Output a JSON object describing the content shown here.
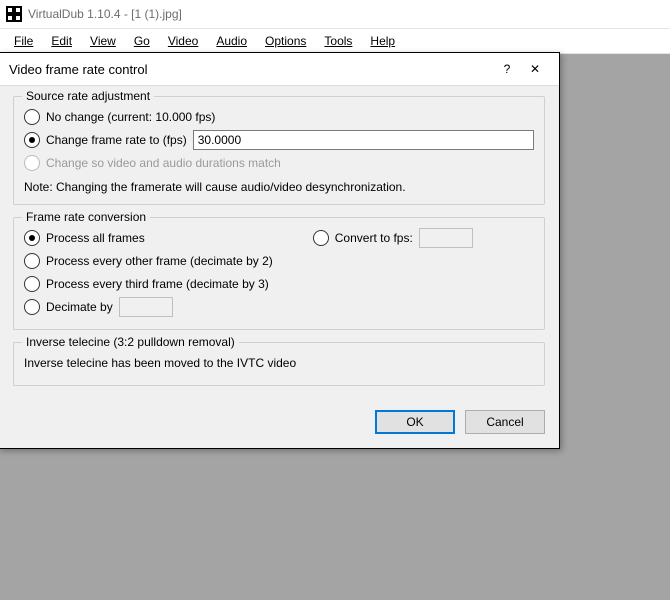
{
  "title": "VirtualDub 1.10.4 - [1 (1).jpg]",
  "menus": {
    "file": "File",
    "edit": "Edit",
    "view": "View",
    "go": "Go",
    "video": "Video",
    "audio": "Audio",
    "options": "Options",
    "tools": "Tools",
    "help": "Help"
  },
  "dialog": {
    "title": "Video frame rate control",
    "help_icon": "?",
    "close_icon": "✕",
    "group_source": {
      "legend": "Source rate adjustment",
      "no_change": "No change (current: 10.000 fps)",
      "change_to": "Change frame rate to (fps)",
      "change_to_value": "30.0000",
      "match": "Change so video and audio durations match",
      "note": "Note: Changing the framerate will cause audio/video desynchronization."
    },
    "group_conv": {
      "legend": "Frame rate conversion",
      "all": "Process all frames",
      "every2": "Process every other frame (decimate by 2)",
      "every3": "Process every third frame (decimate by 3)",
      "decimate": "Decimate by",
      "decimate_value": "",
      "convert": "Convert to fps:",
      "convert_value": ""
    },
    "group_ivtc": {
      "legend": "Inverse telecine (3:2 pulldown removal)",
      "text": "Inverse telecine has been moved to the IVTC video"
    },
    "ok": "OK",
    "cancel": "Cancel"
  }
}
